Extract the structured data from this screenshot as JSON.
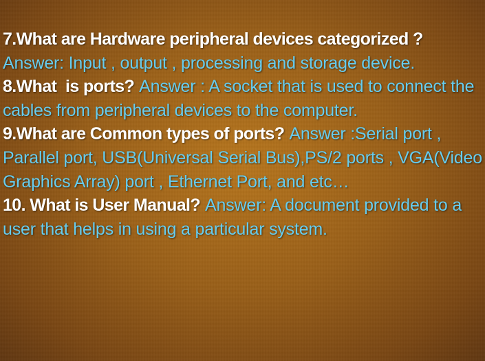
{
  "items": [
    {
      "question": "7.What are Hardware peripheral devices categorized ?",
      "answer": "Answer: Input , output , processing and storage device."
    },
    {
      "question": "8.What  is ports?",
      "answer": "Answer : A socket that is used to connect the cables from peripheral devices to the computer."
    },
    {
      "question": "9.What are Common types of ports?",
      "answer": "Answer :Serial port , Parallel port, USB(Universal Serial Bus),PS/2 ports , VGA(Video Graphics Array) port , Ethernet Port, and etc…"
    },
    {
      "question": "10. What is User Manual?",
      "answer": "Answer: A document provided to a user that helps in using a particular system."
    }
  ],
  "colors": {
    "question": "#ffffff",
    "answer": "#66ccee",
    "background": "#9a5f17"
  }
}
